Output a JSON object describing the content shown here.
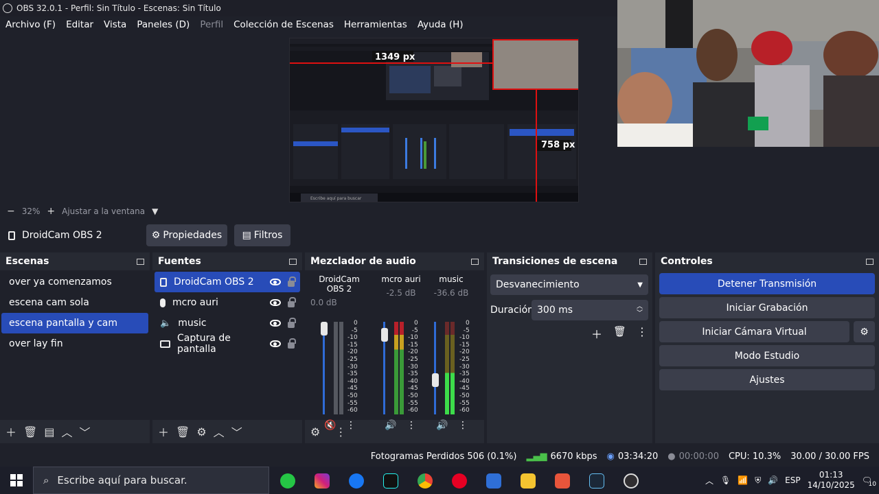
{
  "window": {
    "title": "OBS 32.0.1 - Perfil: Sin Título - Escenas: Sin Título"
  },
  "menu": [
    "Archivo (F)",
    "Editar",
    "Vista",
    "Paneles (D)",
    "Perfil",
    "Colección de Escenas",
    "Herramientas",
    "Ayuda (H)"
  ],
  "preview": {
    "width_label": "1349 px",
    "height_label": "758 px",
    "zoom": "32%",
    "zoom_mode": "Ajustar a la ventana"
  },
  "source_toolbar": {
    "source": "DroidCam OBS 2",
    "properties": "Propiedades",
    "filters": "Filtros"
  },
  "scenes": {
    "title": "Escenas",
    "items": [
      "over ya comenzamos",
      "escena cam sola",
      "escena pantalla y cam",
      "over lay fin"
    ],
    "selected_index": 2
  },
  "sources": {
    "title": "Fuentes",
    "items": [
      {
        "name": "DroidCam OBS 2",
        "icon": "file-icon"
      },
      {
        "name": "mcro auri",
        "icon": "mic-icon"
      },
      {
        "name": "music",
        "icon": "speaker-icon"
      },
      {
        "name": "Captura de pantalla",
        "icon": "monitor-icon"
      }
    ]
  },
  "mixer": {
    "title": "Mezclador de audio",
    "channels": [
      {
        "name": "DroidCam OBS 2",
        "db": "0.0 dB",
        "muted": true,
        "level": 1.0
      },
      {
        "name": "mcro auri",
        "db": "-2.5 dB",
        "muted": false,
        "level": 0.92
      },
      {
        "name": "music",
        "db": "-36.6 dB",
        "muted": false,
        "level": 0.35
      }
    ],
    "scale": [
      "0",
      "-5",
      "-10",
      "-15",
      "-20",
      "-25",
      "-30",
      "-35",
      "-40",
      "-45",
      "-50",
      "-55",
      "-60"
    ]
  },
  "transitions": {
    "title": "Transiciones de escena",
    "type": "Desvanecimiento",
    "duration_label": "Duración",
    "duration": "300 ms"
  },
  "controls": {
    "title": "Controles",
    "buttons": [
      "Detener Transmisión",
      "Iniciar Grabación",
      "Iniciar Cámara Virtual",
      "Modo Estudio",
      "Ajustes"
    ]
  },
  "status": {
    "dropped": "Fotogramas Perdidos 506 (0.1%)",
    "bitrate": "6670 kbps",
    "stream_time": "03:34:20",
    "rec_time": "00:00:00",
    "cpu": "CPU: 10.3%",
    "fps": "30.00 / 30.00 FPS"
  },
  "taskbar": {
    "search_placeholder": "Escribe aquí para buscar.",
    "lang": "ESP",
    "time": "01:13",
    "date": "14/10/2025",
    "notifications": "10"
  }
}
